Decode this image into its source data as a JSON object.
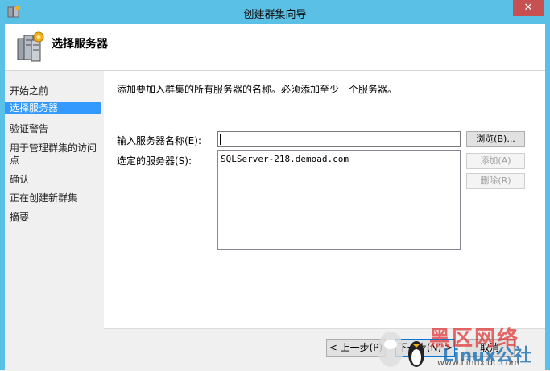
{
  "window": {
    "title": "创建群集向导",
    "close": "✕"
  },
  "header": {
    "title": "选择服务器"
  },
  "sidebar": {
    "steps": [
      {
        "label": "开始之前"
      },
      {
        "label": "选择服务器"
      },
      {
        "label": "验证警告"
      },
      {
        "label": "用于管理群集的访问点"
      },
      {
        "label": "确认"
      },
      {
        "label": "正在创建新群集"
      },
      {
        "label": "摘要"
      }
    ]
  },
  "main": {
    "description": "添加要加入群集的所有服务器的名称。必须添加至少一个服务器。",
    "server_name_label": "输入服务器名称(E):",
    "server_name_value": "",
    "selected_label": "选定的服务器(S):",
    "selected_servers": [
      "SQLServer-218.demoad.com"
    ],
    "browse_label": "浏览(B)...",
    "add_label": "添加(A)",
    "remove_label": "删除(R)"
  },
  "footer": {
    "prev_label": "< 上一步(P)",
    "next_label": "下一步(N) >",
    "cancel_label": "取消"
  },
  "watermark": {
    "line1": "黑区网络",
    "line2": "Linux公社",
    "line3": "www.Linuxidc.com"
  }
}
